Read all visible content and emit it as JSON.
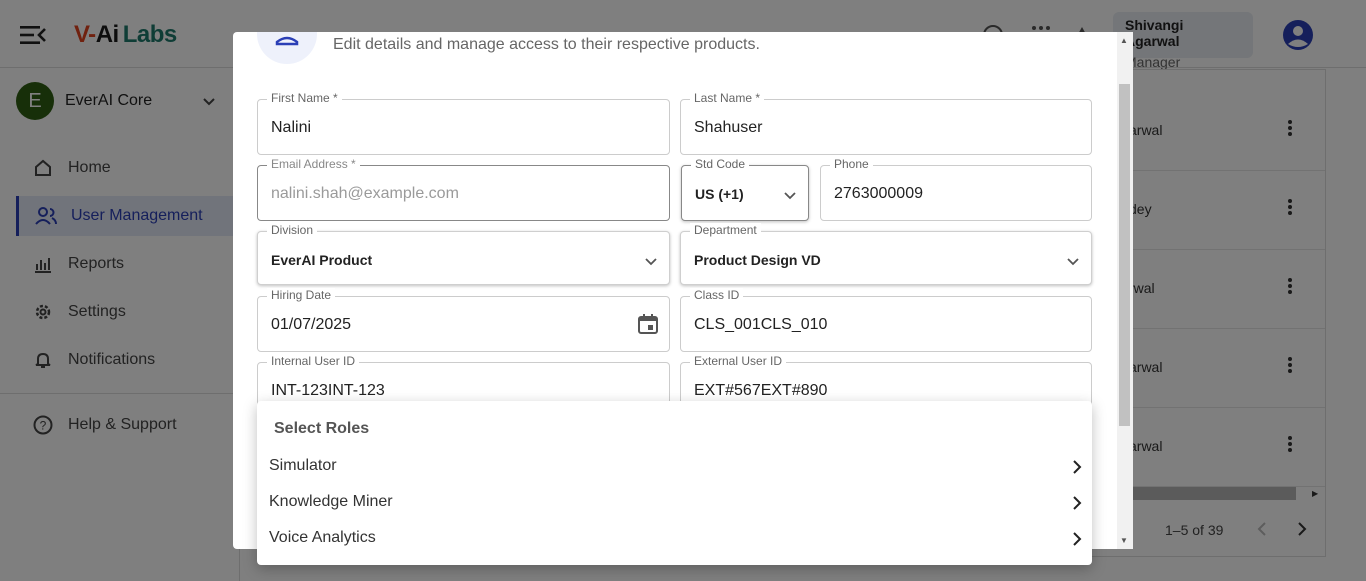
{
  "header": {
    "logo_v": "V-",
    "logo_ai": "Ai",
    "logo_labs": "Labs",
    "user_name": "Shivangi Agarwal",
    "user_role": "Manager",
    "accent_color": "#2b3fb6"
  },
  "sidebar": {
    "org_initial": "E",
    "org_name": "EverAI Core",
    "items": [
      {
        "label": "Home",
        "icon": "home-icon"
      },
      {
        "label": "User Management",
        "icon": "users-icon",
        "active": true
      },
      {
        "label": "Reports",
        "icon": "chart-icon"
      },
      {
        "label": "Settings",
        "icon": "gear-icon"
      },
      {
        "label": "Notifications",
        "icon": "bell-icon"
      }
    ],
    "help_label": "Help & Support"
  },
  "table": {
    "rows": [
      "arwal",
      "dey",
      "rwal",
      "arwal",
      "arwal"
    ],
    "pagination": "1–5 of 39"
  },
  "modal": {
    "subtitle": "Edit details and manage access to their respective products.",
    "fields": {
      "first_name": {
        "label": "First Name *",
        "value": "Nalini"
      },
      "last_name": {
        "label": "Last Name *",
        "value": "Shahuser"
      },
      "email": {
        "label": "Email Address *",
        "placeholder": "nalini.shah@example.com"
      },
      "std_code": {
        "label": "Std Code",
        "value": "US (+1)"
      },
      "phone": {
        "label": "Phone",
        "value": "2763000009"
      },
      "division": {
        "label": "Division",
        "value": "EverAI Product"
      },
      "department": {
        "label": "Department",
        "value": "Product Design VD"
      },
      "hiring_date": {
        "label": "Hiring Date",
        "value": "01/07/2025"
      },
      "class_id": {
        "label": "Class ID",
        "value": "CLS_001CLS_010"
      },
      "internal_id": {
        "label": "Internal User ID",
        "value": "INT-123INT-123"
      },
      "external_id": {
        "label": "External User ID",
        "value": "EXT#567EXT#890"
      }
    }
  },
  "roles": {
    "title": "Select Roles",
    "items": [
      "Simulator",
      "Knowledge Miner",
      "Voice Analytics"
    ]
  }
}
